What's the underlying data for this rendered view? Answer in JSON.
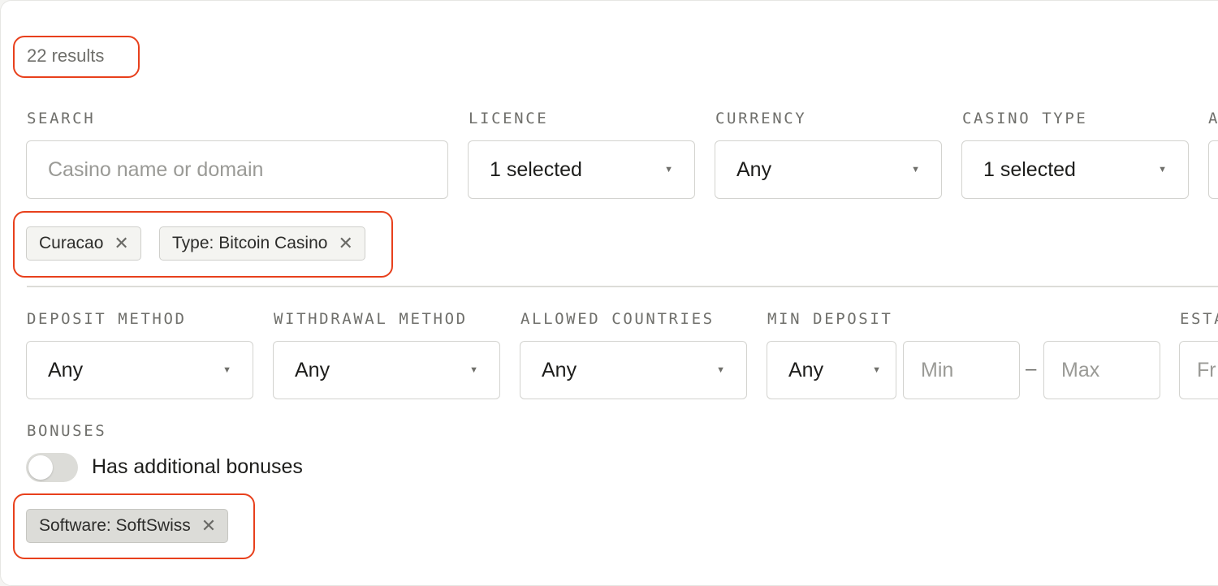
{
  "results_count": "22 results",
  "filters_row1": {
    "search": {
      "label": "SEARCH",
      "placeholder": "Casino name or domain"
    },
    "licence": {
      "label": "LICENCE",
      "value": "1 selected"
    },
    "currency": {
      "label": "CURRENCY",
      "value": "Any"
    },
    "casino_type": {
      "label": "CASINO TYPE",
      "value": "1 selected"
    },
    "cut_off_label": "A"
  },
  "active_chips_row1": [
    {
      "label": "Curacao"
    },
    {
      "label": "Type: Bitcoin Casino"
    }
  ],
  "filters_row2": {
    "deposit_method": {
      "label": "DEPOSIT METHOD",
      "value": "Any"
    },
    "withdrawal_method": {
      "label": "WITHDRAWAL METHOD",
      "value": "Any"
    },
    "allowed_countries": {
      "label": "ALLOWED COUNTRIES",
      "value": "Any"
    },
    "min_deposit": {
      "label": "MIN DEPOSIT",
      "value": "Any",
      "min_placeholder": "Min",
      "max_placeholder": "Max",
      "range_separator": "–"
    },
    "established": {
      "label": "ESTA",
      "placeholder": "Fr"
    }
  },
  "bonuses": {
    "label": "BONUSES",
    "toggle_label": "Has additional bonuses",
    "toggle_on": false
  },
  "active_chips_row2": [
    {
      "label": "Software: SoftSwiss"
    }
  ],
  "colors": {
    "highlight": "#e8401c",
    "chip_bg": "#f4f4f1",
    "chip_dark_bg": "#dcdcd8",
    "border": "#d3d3cf"
  },
  "icons": {
    "chip_remove": "close-icon",
    "select_caret": "caret-down-icon"
  }
}
